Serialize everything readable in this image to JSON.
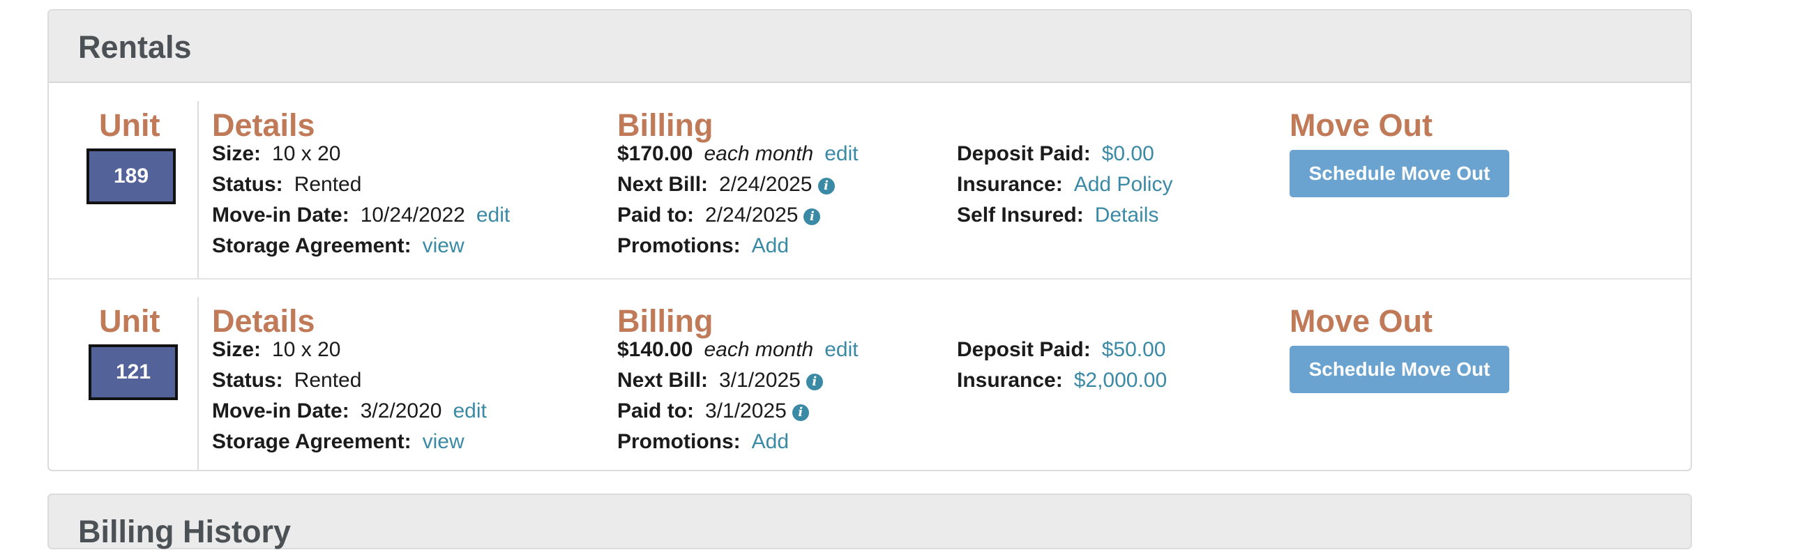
{
  "rentals_panel": {
    "title": "Rentals"
  },
  "headings": {
    "unit": "Unit",
    "details": "Details",
    "billing": "Billing",
    "move_out": "Move Out"
  },
  "labels": {
    "size": "Size:",
    "status": "Status:",
    "move_in": "Move-in Date:",
    "storage_agreement": "Storage Agreement:",
    "next_bill": "Next Bill:",
    "paid_to": "Paid to:",
    "promotions": "Promotions:",
    "deposit_paid": "Deposit Paid:",
    "insurance": "Insurance:",
    "self_insured": "Self Insured:",
    "each_month": "each month"
  },
  "rentals": [
    {
      "unit": "189",
      "size": "10 x 20",
      "status": "Rented",
      "move_in": "10/24/2022",
      "move_in_edit": "edit",
      "storage_agreement_link": "view",
      "rate": "$170.00",
      "rate_edit": "edit",
      "next_bill": "2/24/2025",
      "paid_to": "2/24/2025",
      "promotions_link": "Add",
      "deposit_paid": "$0.00",
      "insurance": "Add Policy",
      "self_insured": "Details",
      "button": "Schedule Move Out"
    },
    {
      "unit": "121",
      "size": "10 x 20",
      "status": "Rented",
      "move_in": "3/2/2020",
      "move_in_edit": "edit",
      "storage_agreement_link": "view",
      "rate": "$140.00",
      "rate_edit": "edit",
      "next_bill": "3/1/2025",
      "paid_to": "3/1/2025",
      "promotions_link": "Add",
      "deposit_paid": "$50.00",
      "insurance": "$2,000.00",
      "button": "Schedule Move Out"
    }
  ],
  "billing_history_panel": {
    "title": "Billing History"
  },
  "icons": {
    "info": "i"
  },
  "colors": {
    "heading": "#c07a58",
    "link": "#3a8aa5",
    "button": "#6aa3cf",
    "unit_badge": "#536299"
  }
}
